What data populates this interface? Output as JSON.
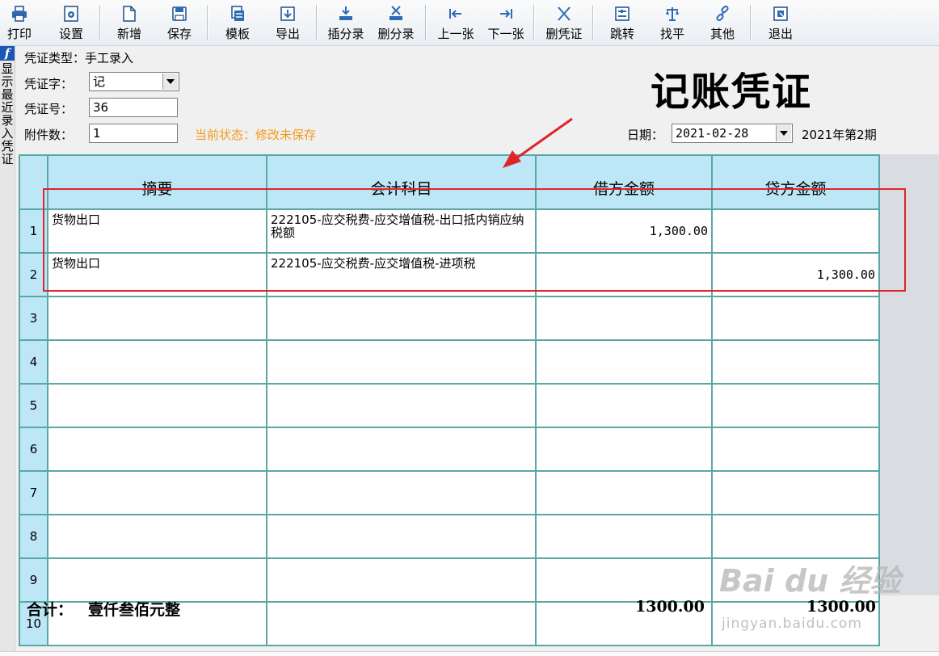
{
  "toolbar": {
    "items": [
      {
        "label": "打印",
        "icon": "printer-icon"
      },
      {
        "label": "设置",
        "icon": "settings-icon"
      },
      {
        "label": "新增",
        "icon": "new-file-icon"
      },
      {
        "label": "保存",
        "icon": "save-icon"
      },
      {
        "label": "模板",
        "icon": "template-icon"
      },
      {
        "label": "导出",
        "icon": "export-icon"
      },
      {
        "label": "插分录",
        "icon": "insert-entry-icon"
      },
      {
        "label": "删分录",
        "icon": "delete-entry-icon"
      },
      {
        "label": "上一张",
        "icon": "previous-icon"
      },
      {
        "label": "下一张",
        "icon": "next-icon"
      },
      {
        "label": "删凭证",
        "icon": "delete-voucher-icon"
      },
      {
        "label": "跳转",
        "icon": "jump-icon"
      },
      {
        "label": "找平",
        "icon": "balance-icon"
      },
      {
        "label": "其他",
        "icon": "link-icon"
      },
      {
        "label": "退出",
        "icon": "exit-icon"
      }
    ]
  },
  "side": {
    "logo": "f",
    "text": "显示最近录入凭证"
  },
  "header": {
    "voucher_type_label": "凭证类型：手工录入",
    "voucher_word_label": "凭证字：",
    "voucher_word_value": "记",
    "voucher_no_label": "凭证号：",
    "voucher_no_value": "36",
    "attachments_label": "附件数：",
    "attachments_value": "1",
    "status_text": "当前状态：修改未保存",
    "title": "记账凭证",
    "date_label": "日期：",
    "date_value": "2021-02-28",
    "period": "2021年第2期"
  },
  "grid": {
    "columns": [
      "摘要",
      "会计科目",
      "借方金额",
      "贷方金额"
    ],
    "rows": [
      {
        "n": "1",
        "summary": "货物出口",
        "account": "222105-应交税费-应交增值税-出口抵内销应纳税额",
        "debit": "1,300.00",
        "credit": ""
      },
      {
        "n": "2",
        "summary": "货物出口",
        "account": "222105-应交税费-应交增值税-进项税",
        "debit": "",
        "credit": "1,300.00"
      },
      {
        "n": "3",
        "summary": "",
        "account": "",
        "debit": "",
        "credit": ""
      },
      {
        "n": "4",
        "summary": "",
        "account": "",
        "debit": "",
        "credit": ""
      },
      {
        "n": "5",
        "summary": "",
        "account": "",
        "debit": "",
        "credit": ""
      },
      {
        "n": "6",
        "summary": "",
        "account": "",
        "debit": "",
        "credit": ""
      },
      {
        "n": "7",
        "summary": "",
        "account": "",
        "debit": "",
        "credit": ""
      },
      {
        "n": "8",
        "summary": "",
        "account": "",
        "debit": "",
        "credit": ""
      },
      {
        "n": "9",
        "summary": "",
        "account": "",
        "debit": "",
        "credit": ""
      },
      {
        "n": "10",
        "summary": "",
        "account": "",
        "debit": "",
        "credit": ""
      }
    ]
  },
  "footer": {
    "total_label": "合计：",
    "total_words": "壹仟叁佰元整",
    "debit_total": "1300.00",
    "credit_total": "1300.00"
  },
  "watermark": {
    "text": "Bai du 经验",
    "sub": "jingyan.baidu.com"
  },
  "colors": {
    "status": "#f39a1b",
    "header_cell": "#bde6f6",
    "grid_line": "#5aa7a3",
    "annotation": "#e0242a"
  }
}
